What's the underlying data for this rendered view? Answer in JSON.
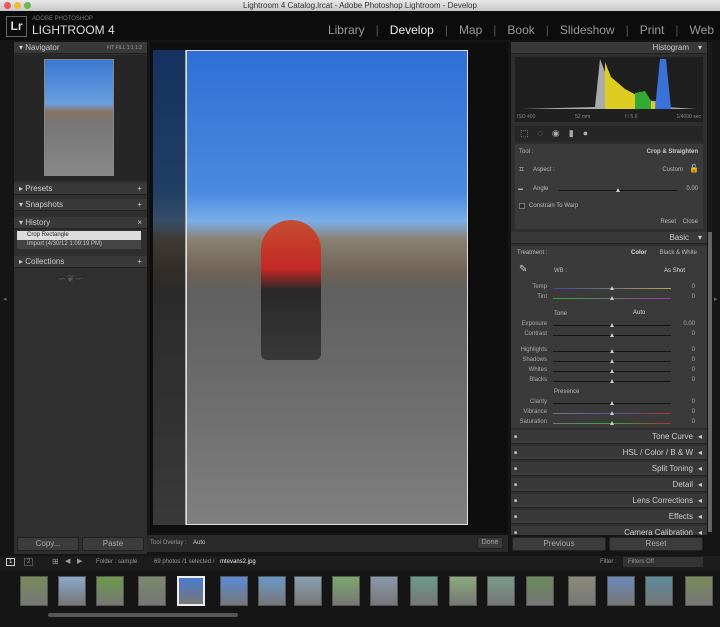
{
  "window": {
    "title": "Lightroom 4 Catalog.lrcat - Adobe Photoshop Lightroom - Develop"
  },
  "brand": {
    "logo": "Lr",
    "line1": "ADOBE PHOTOSHOP",
    "line2": "LIGHTROOM 4"
  },
  "modules": [
    "Library",
    "Develop",
    "Map",
    "Book",
    "Slideshow",
    "Print",
    "Web"
  ],
  "active_module": "Develop",
  "left": {
    "navigator": {
      "title": "Navigator",
      "zoom": [
        "FIT",
        "FILL",
        "1:1",
        "1:2"
      ]
    },
    "presets": "Presets",
    "snapshots": "Snapshots",
    "history": {
      "title": "History",
      "items": [
        "Crop Rectangle",
        "Import (4/30/12 1:09:19 PM)"
      ]
    },
    "collections": "Collections",
    "copy": "Copy...",
    "paste": "Paste"
  },
  "toolbar": {
    "overlay_label": "Tool Overlay :",
    "overlay_value": "Auto",
    "done": "Done"
  },
  "right": {
    "histogram": {
      "title": "Histogram",
      "iso": "ISO 400",
      "focal": "52 mm",
      "aperture": "f / 5.6",
      "shutter": "1/4000 sec"
    },
    "crop": {
      "tool_label": "Tool :",
      "tool_value": "Crop & Straighten",
      "aspect_label": "Aspect :",
      "aspect_value": "Custom",
      "angle_label": "Angle",
      "angle_value": "0.00",
      "constrain": "Constrain To Warp",
      "reset": "Reset",
      "close": "Close"
    },
    "basic": {
      "title": "Basic",
      "treatment": "Treatment :",
      "color": "Color",
      "bw": "Black & White",
      "wb": "WB :",
      "wb_value": "As Shot",
      "wb_sliders": [
        {
          "label": "Temp",
          "value": "0"
        },
        {
          "label": "Tint",
          "value": "0"
        }
      ],
      "tone": "Tone",
      "auto": "Auto",
      "tone_sliders": [
        {
          "label": "Exposure",
          "value": "0.00"
        },
        {
          "label": "Contrast",
          "value": "0"
        },
        {
          "label": "Highlights",
          "value": "0"
        },
        {
          "label": "Shadows",
          "value": "0"
        },
        {
          "label": "Whites",
          "value": "0"
        },
        {
          "label": "Blacks",
          "value": "0"
        }
      ],
      "presence": "Presence",
      "presence_sliders": [
        {
          "label": "Clarity",
          "value": "0"
        },
        {
          "label": "Vibrance",
          "value": "0"
        },
        {
          "label": "Saturation",
          "value": "0"
        }
      ]
    },
    "panels": [
      "Tone Curve",
      "HSL / Color / B & W",
      "Split Toning",
      "Detail",
      "Lens Corrections",
      "Effects",
      "Camera Calibration"
    ],
    "previous": "Previous",
    "reset": "Reset"
  },
  "filmstrip": {
    "pages": [
      "1",
      "2"
    ],
    "folder": "Folder : sample",
    "count": "69 photos /1 selected /",
    "file": "mtevans2.jpg",
    "filter_label": "Filter :",
    "filter_value": "Filters Off"
  }
}
